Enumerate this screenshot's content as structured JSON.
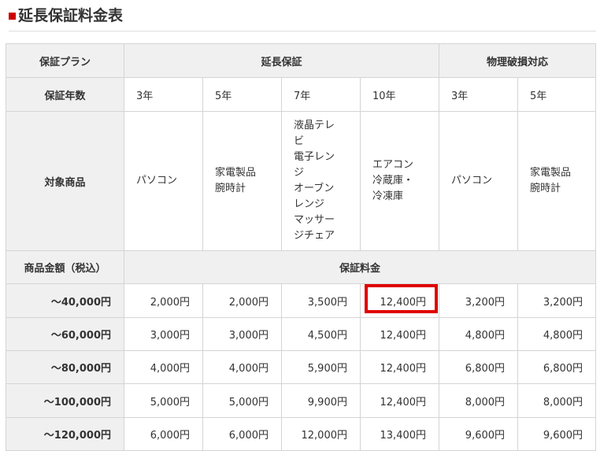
{
  "heading": {
    "title": "延長保証料金表",
    "accent_color": "#cc0000"
  },
  "table": {
    "plan_label": "保証プラン",
    "extended_label": "延長保証",
    "physical_label": "物理破損対応",
    "years_label": "保証年数",
    "years": [
      "3年",
      "5年",
      "7年",
      "10年",
      "3年",
      "5年"
    ],
    "products_label": "対象商品",
    "products": [
      [
        "パソコン"
      ],
      [
        "家電製品",
        "腕時計"
      ],
      [
        "液晶テレ",
        "ビ",
        "電子レン",
        "ジ",
        "オーブン",
        "レンジ",
        "マッサー",
        "ジチェア"
      ],
      [
        "エアコン",
        "冷蔵庫・",
        "冷凍庫"
      ],
      [
        "パソコン"
      ],
      [
        "家電製品",
        "腕時計"
      ]
    ],
    "price_label": "商品金額（税込）",
    "fee_label": "保証料金",
    "rows": [
      {
        "price": "～40,000円",
        "fees": [
          "2,000円",
          "2,000円",
          "3,500円",
          "12,400円",
          "3,200円",
          "3,200円"
        ]
      },
      {
        "price": "～60,000円",
        "fees": [
          "3,000円",
          "3,000円",
          "4,500円",
          "12,400円",
          "4,800円",
          "4,800円"
        ]
      },
      {
        "price": "～80,000円",
        "fees": [
          "4,000円",
          "4,000円",
          "5,900円",
          "12,400円",
          "6,800円",
          "6,800円"
        ]
      },
      {
        "price": "～100,000円",
        "fees": [
          "5,000円",
          "5,000円",
          "9,900円",
          "12,400円",
          "8,000円",
          "8,000円"
        ]
      },
      {
        "price": "～120,000円",
        "fees": [
          "6,000円",
          "6,000円",
          "12,000円",
          "13,400円",
          "9,600円",
          "9,600円"
        ]
      }
    ]
  }
}
